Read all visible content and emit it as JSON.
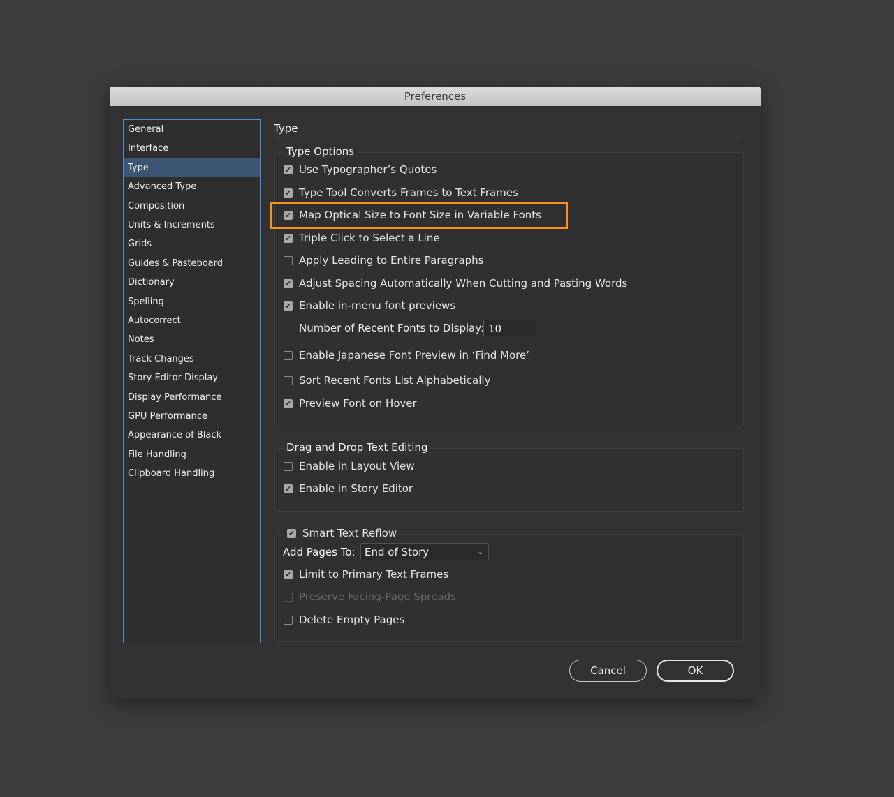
{
  "window": {
    "title": "Preferences"
  },
  "sidebar": {
    "items": [
      {
        "label": "General"
      },
      {
        "label": "Interface"
      },
      {
        "label": "Type",
        "selected": true
      },
      {
        "label": "Advanced Type"
      },
      {
        "label": "Composition"
      },
      {
        "label": "Units & Increments"
      },
      {
        "label": "Grids"
      },
      {
        "label": "Guides & Pasteboard"
      },
      {
        "label": "Dictionary"
      },
      {
        "label": "Spelling"
      },
      {
        "label": "Autocorrect"
      },
      {
        "label": "Notes"
      },
      {
        "label": "Track Changes"
      },
      {
        "label": "Story Editor Display"
      },
      {
        "label": "Display Performance"
      },
      {
        "label": "GPU Performance"
      },
      {
        "label": "Appearance of Black"
      },
      {
        "label": "File Handling"
      },
      {
        "label": "Clipboard Handling"
      }
    ]
  },
  "main": {
    "title": "Type",
    "type_options": {
      "legend": "Type Options",
      "options": [
        {
          "label": "Use Typographer’s Quotes",
          "checked": true
        },
        {
          "label": "Type Tool Converts Frames to Text Frames",
          "checked": true
        },
        {
          "label": "Map Optical Size to Font Size in Variable Fonts",
          "checked": true
        },
        {
          "label": "Triple Click to Select a Line",
          "checked": true
        },
        {
          "label": "Apply Leading to Entire Paragraphs",
          "checked": false
        },
        {
          "label": "Adjust Spacing Automatically When Cutting and Pasting Words",
          "checked": true
        },
        {
          "label": "Enable in-menu font previews",
          "checked": true
        },
        {
          "label": "Enable Japanese Font Preview in ‘Find More’",
          "checked": false
        },
        {
          "label": "Sort Recent Fonts List Alphabetically",
          "checked": false
        },
        {
          "label": "Preview Font on Hover",
          "checked": true
        }
      ],
      "recent_fonts_label": "Number of Recent Fonts to Display:",
      "recent_fonts_value": "10"
    },
    "drag_drop": {
      "legend": "Drag and Drop Text Editing",
      "options": [
        {
          "label": "Enable in Layout View",
          "checked": false
        },
        {
          "label": "Enable in Story Editor",
          "checked": true
        }
      ]
    },
    "smart_reflow": {
      "legend": "Smart Text Reflow",
      "checked": true,
      "add_pages_label": "Add Pages To:",
      "add_pages_value": "End of Story",
      "options": [
        {
          "label": "Limit to Primary Text Frames",
          "checked": true
        },
        {
          "label": "Preserve Facing-Page Spreads",
          "checked": false,
          "disabled": true
        },
        {
          "label": "Delete Empty Pages",
          "checked": false
        }
      ]
    }
  },
  "buttons": {
    "cancel": "Cancel",
    "ok": "OK"
  },
  "colors": {
    "highlight": "#f7931e",
    "selection": "#3b5573",
    "sidebar_border": "#4a90d9"
  }
}
